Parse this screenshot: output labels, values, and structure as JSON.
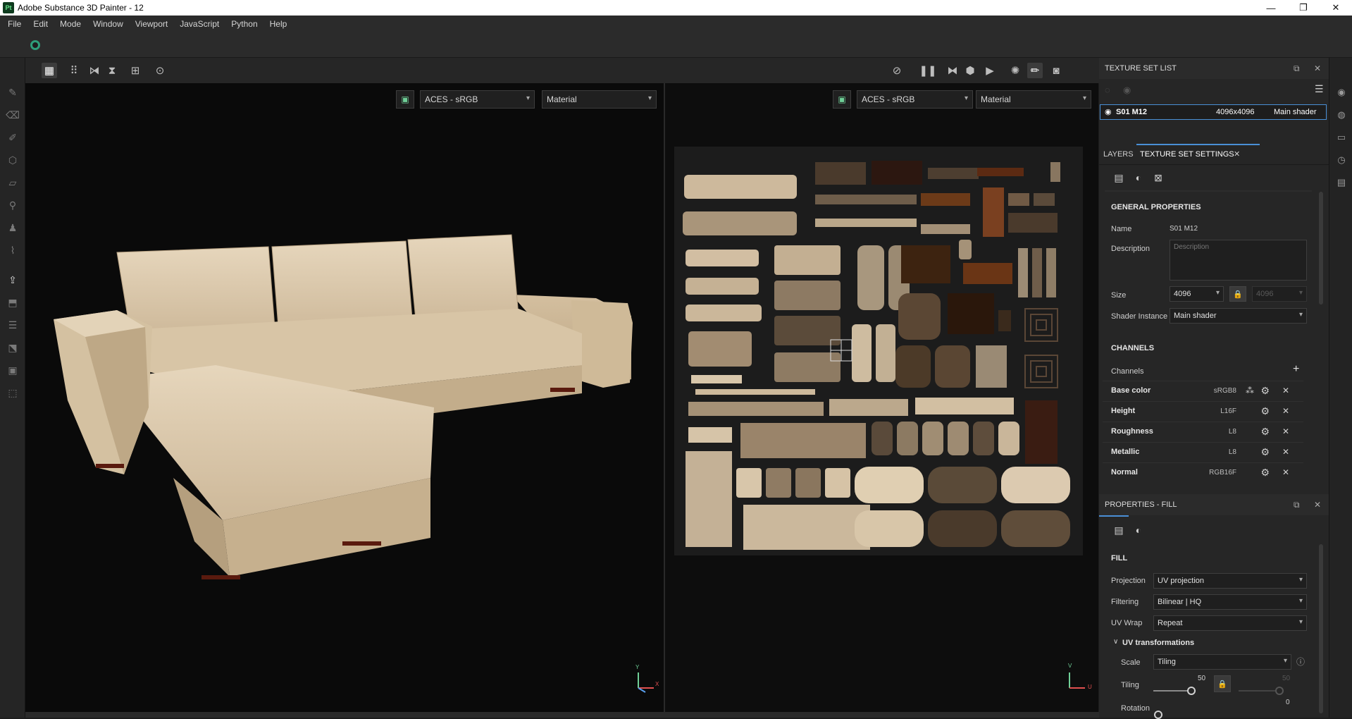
{
  "window": {
    "title": "Adobe Substance 3D Painter - 12",
    "logo_text": "Pt",
    "controls": [
      "—",
      "❐",
      "✕"
    ]
  },
  "menu": [
    "File",
    "Edit",
    "Mode",
    "Window",
    "Viewport",
    "JavaScript",
    "Python",
    "Help"
  ],
  "viewport3d": {
    "color_profile": "ACES - sRGB",
    "display_mode": "Material",
    "axis_y": "Y",
    "axis_x": "X"
  },
  "viewport2d": {
    "color_profile": "ACES - sRGB",
    "display_mode": "Material",
    "axis_v": "V",
    "axis_u": "U"
  },
  "texture_set_list": {
    "title": "TEXTURE SET LIST",
    "item": {
      "name": "S01 M12",
      "size": "4096x4096",
      "shader": "Main shader"
    }
  },
  "tabs": {
    "layers": "LAYERS",
    "tss": "TEXTURE SET SETTINGS",
    "close": "✕"
  },
  "general": {
    "title": "GENERAL PROPERTIES",
    "name_label": "Name",
    "name_value": "S01 M12",
    "description_label": "Description",
    "description_placeholder": "Description",
    "size_label": "Size",
    "size_value": "4096",
    "size_value2": "4096",
    "shader_label": "Shader Instance",
    "shader_value": "Main shader"
  },
  "channels": {
    "title": "CHANNELS",
    "label": "Channels",
    "add": "+",
    "items": [
      {
        "name": "Base color",
        "format": "sRGB8"
      },
      {
        "name": "Height",
        "format": "L16F"
      },
      {
        "name": "Roughness",
        "format": "L8"
      },
      {
        "name": "Metallic",
        "format": "L8"
      },
      {
        "name": "Normal",
        "format": "RGB16F"
      }
    ]
  },
  "properties": {
    "title": "PROPERTIES - FILL",
    "fill_title": "FILL",
    "projection_label": "Projection",
    "projection_value": "UV projection",
    "filtering_label": "Filtering",
    "filtering_value": "Bilinear | HQ",
    "uvwrap_label": "UV Wrap",
    "uvwrap_value": "Repeat",
    "uvtrans_title": "UV transformations",
    "scale_label": "Scale",
    "scale_value": "Tiling",
    "tiling_label": "Tiling",
    "tiling_value": "50",
    "tiling_value2": "50",
    "tiling_fraction": 0.5,
    "rotation_label": "Rotation",
    "rotation_value": "0"
  },
  "colors": {
    "accent": "#4a8fd6",
    "sofa": "#d9c4a4",
    "spinner": "#2e9e7a"
  }
}
